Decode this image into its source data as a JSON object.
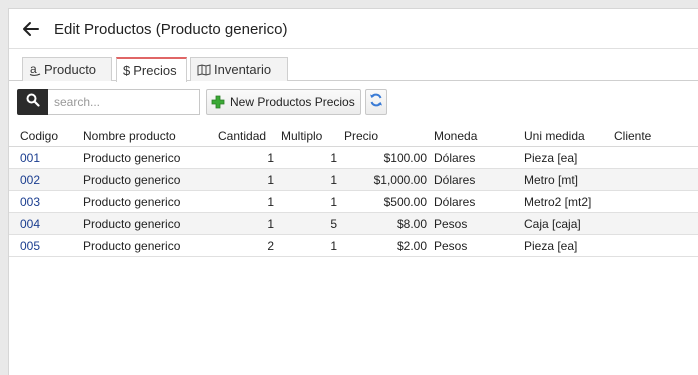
{
  "header": {
    "title": "Edit Productos (Producto generico)",
    "back_icon": "arrow-left-icon"
  },
  "tabs": [
    {
      "label": "Producto",
      "icon": "amazon-icon",
      "active": false
    },
    {
      "label": "Precios",
      "icon": "dollar-icon",
      "active": true
    },
    {
      "label": "Inventario",
      "icon": "map-icon",
      "active": false
    }
  ],
  "toolbar": {
    "search_placeholder": "search...",
    "new_button_label": "New Productos Precios"
  },
  "grid": {
    "columns": [
      "Codigo",
      "Nombre producto",
      "Cantidad",
      "Multiplo",
      "Precio",
      "Moneda",
      "Uni medida",
      "Cliente"
    ],
    "rows": [
      {
        "codigo": "001",
        "nombre": "Producto generico",
        "cantidad": "1",
        "multiplo": "1",
        "precio": "$100.00",
        "moneda": "Dólares",
        "unimedida": "Pieza [ea]",
        "cliente": ""
      },
      {
        "codigo": "002",
        "nombre": "Producto generico",
        "cantidad": "1",
        "multiplo": "1",
        "precio": "$1,000.00",
        "moneda": "Dólares",
        "unimedida": "Metro [mt]",
        "cliente": ""
      },
      {
        "codigo": "003",
        "nombre": "Producto generico",
        "cantidad": "1",
        "multiplo": "1",
        "precio": "$500.00",
        "moneda": "Dólares",
        "unimedida": "Metro2 [mt2]",
        "cliente": ""
      },
      {
        "codigo": "004",
        "nombre": "Producto generico",
        "cantidad": "1",
        "multiplo": "5",
        "precio": "$8.00",
        "moneda": "Pesos",
        "unimedida": "Caja [caja]",
        "cliente": ""
      },
      {
        "codigo": "005",
        "nombre": "Producto generico",
        "cantidad": "2",
        "multiplo": "1",
        "precio": "$2.00",
        "moneda": "Pesos",
        "unimedida": "Pieza [ea]",
        "cliente": ""
      }
    ]
  },
  "colors": {
    "link": "#1a3d8f",
    "active_tab_accent": "#e06666",
    "plus_green": "#3aa935",
    "search_bg": "#2b2b2b"
  }
}
